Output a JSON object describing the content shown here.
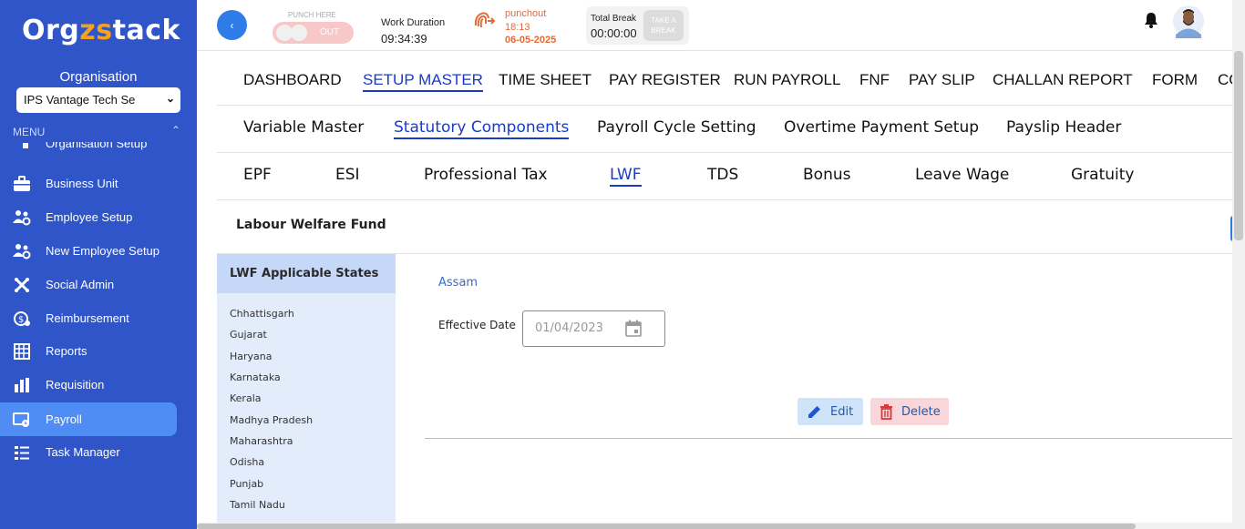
{
  "sidebar": {
    "logo_main": "Org",
    "logo_accent": "zs",
    "logo_rest": "tack",
    "org_label": "Organisation",
    "org_selected": "IPS Vantage Tech Se",
    "menu_label": "MENU",
    "items": [
      {
        "label": "Organisation Setup",
        "icon": "org-setup-icon"
      },
      {
        "label": "Business Unit",
        "icon": "briefcase-icon"
      },
      {
        "label": "Employee Setup",
        "icon": "users-gear-icon"
      },
      {
        "label": "New Employee Setup",
        "icon": "users-gear-icon"
      },
      {
        "label": "Social Admin",
        "icon": "joomla-icon"
      },
      {
        "label": "Reimbursement",
        "icon": "money-icon"
      },
      {
        "label": "Reports",
        "icon": "grid-report-icon"
      },
      {
        "label": "Requisition",
        "icon": "requisition-icon"
      },
      {
        "label": "Payroll",
        "icon": "payroll-icon",
        "active": true
      },
      {
        "label": "Task Manager",
        "icon": "task-list-icon"
      }
    ]
  },
  "topbar": {
    "punch_here": "PUNCH HERE",
    "toggle_state": "OUT",
    "work_duration_label": "Work Duration",
    "work_duration_value": "09:34:39",
    "punchout_label": "punchout",
    "punchout_time": "18:13",
    "punchout_date": "06-05-2025",
    "total_break_label": "Total Break",
    "total_break_value": "00:00:00",
    "take_break_line1": "TAKE A",
    "take_break_line2": "BREAK"
  },
  "main_tabs": [
    "DASHBOARD",
    "SETUP MASTER",
    "TIME SHEET",
    "PAY REGISTER",
    "RUN PAYROLL",
    "FNF",
    "PAY SLIP",
    "CHALLAN REPORT",
    "FORM",
    "CO"
  ],
  "sub_tabs": [
    "Variable Master",
    "Statutory Components",
    "Payroll Cycle Setting",
    "Overtime Payment Setup",
    "Payslip Header"
  ],
  "statutory_tabs": [
    "EPF",
    "ESI",
    "Professional Tax",
    "LWF",
    "TDS",
    "Bonus",
    "Leave Wage",
    "Gratuity"
  ],
  "lwf": {
    "title": "Labour Welfare Fund",
    "states_heading": "LWF Applicable States",
    "states": [
      "Chhattisgarh",
      "Gujarat",
      "Haryana",
      "Karnataka",
      "Kerala",
      "Madhya Pradesh",
      "Maharashtra",
      "Odisha",
      "Punjab",
      "Tamil Nadu"
    ],
    "selected_state": "Assam",
    "effective_date_label": "Effective Date",
    "effective_date_value": "01/04/2023",
    "edit_label": "Edit",
    "delete_label": "Delete"
  },
  "colors": {
    "sidebar_bg": "#2f55c8",
    "active_item": "#4f8cf4",
    "active_tab": "#1a3bc8",
    "punchout": "#e26b3a"
  }
}
